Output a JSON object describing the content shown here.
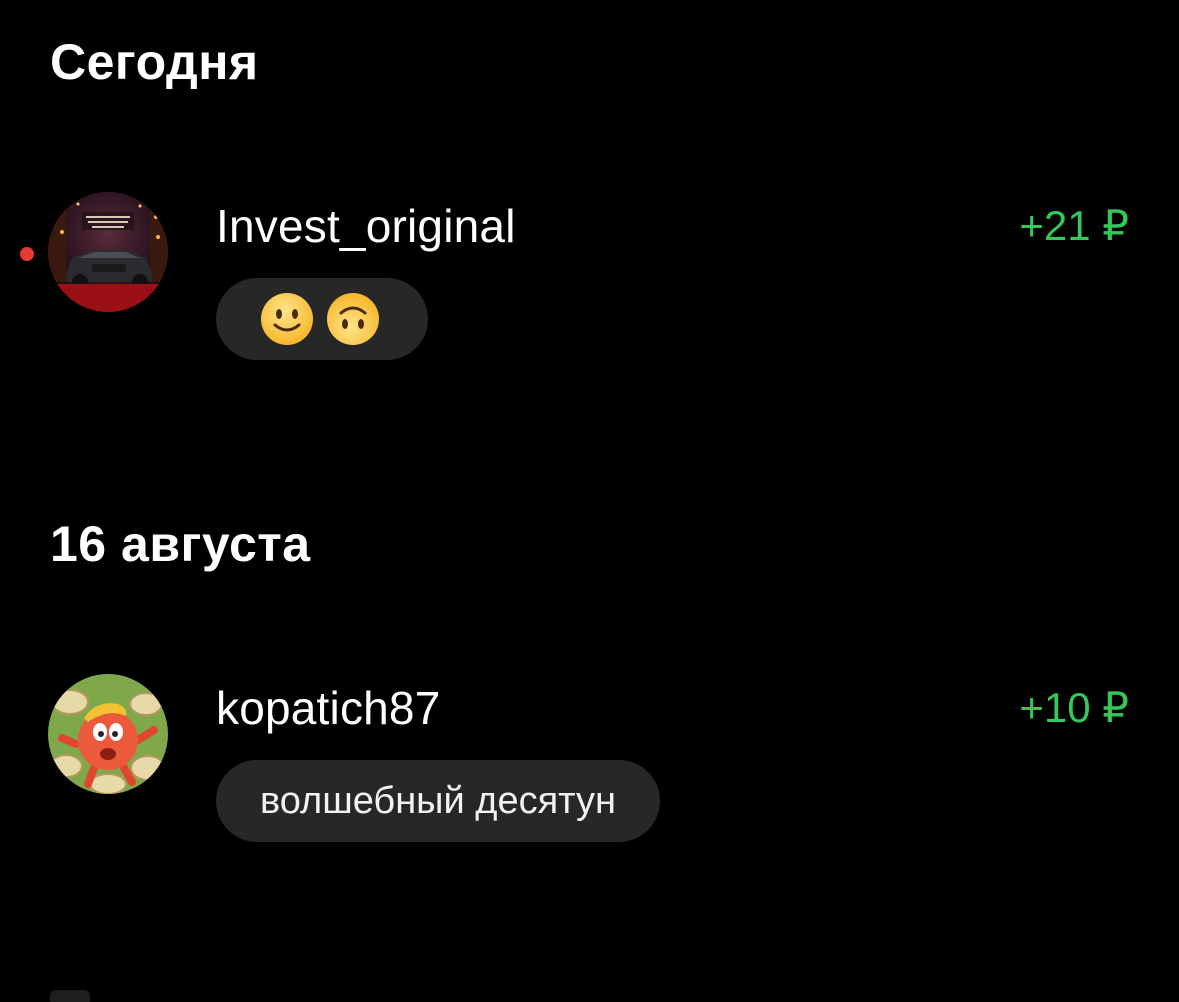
{
  "sections": [
    {
      "title": "Сегодня",
      "items": [
        {
          "username": "Invest_original",
          "amount": "+21 ₽",
          "message_emojis": [
            "slightly-smiling-face",
            "upside-down-face"
          ],
          "unread": true
        }
      ]
    },
    {
      "title": "16 августа",
      "items": [
        {
          "username": "kopatich87",
          "amount": "+10 ₽",
          "message": "волшебный десятун",
          "unread": false
        }
      ]
    }
  ],
  "colors": {
    "background": "#000000",
    "text": "#ffffff",
    "amount_positive": "#34c759",
    "bubble": "#272727",
    "unread_dot": "#e53935"
  },
  "icons": {
    "emoji_1": "slightly-smiling-face-icon",
    "emoji_2": "upside-down-face-icon"
  }
}
